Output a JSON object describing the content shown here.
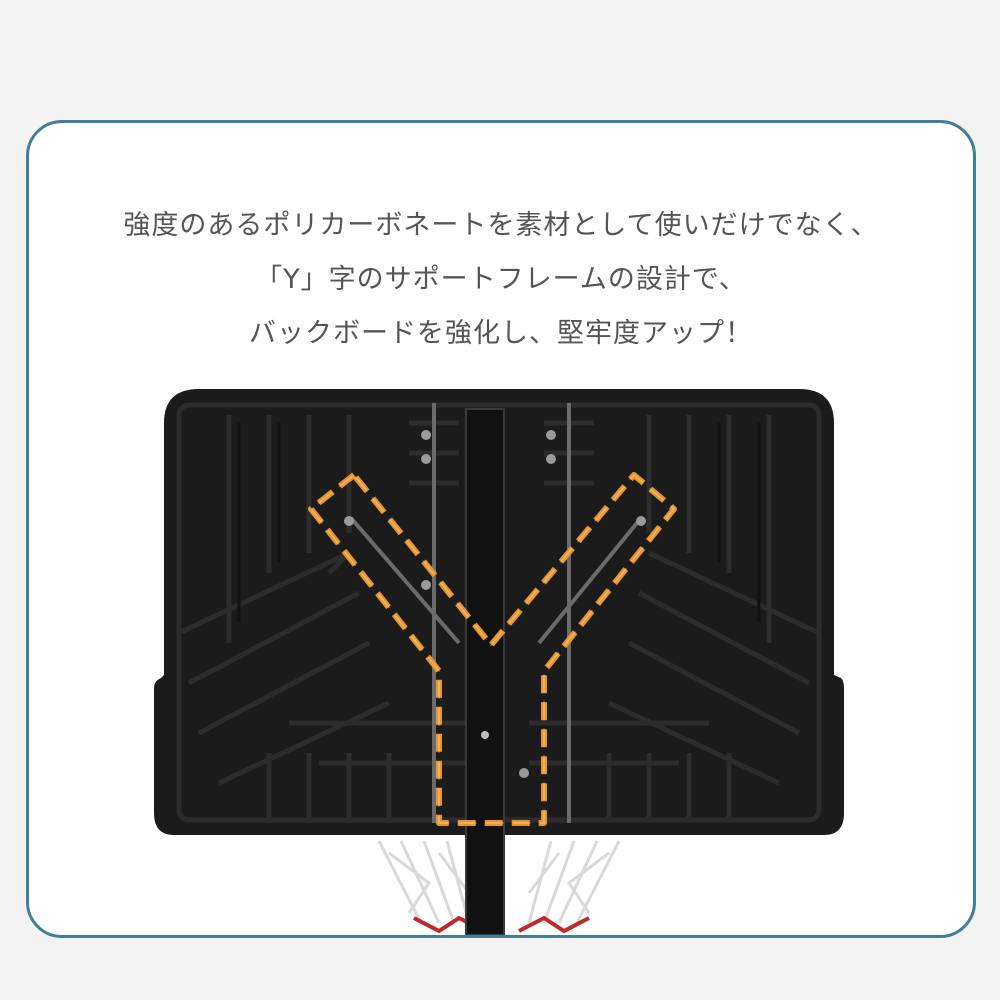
{
  "headline": {
    "line1": "強度のあるポリカーボネートを素材として使いだけでなく、",
    "line2": "「Y」字のサポートフレームの設計で、",
    "line3": "バックボードを強化し、堅牢度アップ！"
  },
  "colors": {
    "frame_border": "#3f7f98",
    "highlight_dash": "#e8952e",
    "backboard": "#1b1b1b",
    "text": "#555555"
  }
}
